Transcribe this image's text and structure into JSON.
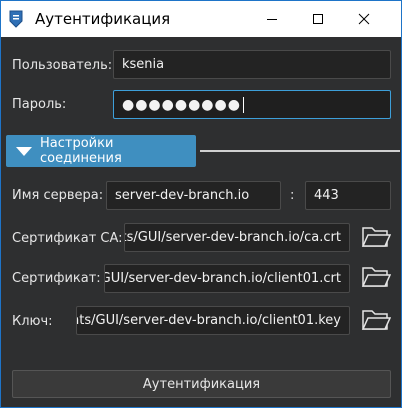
{
  "window": {
    "title": "Аутентификация"
  },
  "form": {
    "user_label": "Пользователь:",
    "user_value": "ksenia",
    "password_label": "Пароль:",
    "password_value": "●●●●●●●●●",
    "section_label": "Настройки соединения",
    "server_label": "Имя сервера:",
    "server_value": "server-dev-branch.io",
    "port_separator": ":",
    "port_value": "443",
    "ca_label": "Сертификат CA:",
    "ca_value": "ts/GUI/server-dev-branch.io/ca.crt",
    "cert_label": "Сертификат:",
    "cert_value": "/GUI/server-dev-branch.io/client01.crt",
    "key_label": "Ключ:",
    "key_value": "nts/GUI/server-dev-branch.io/client01.key",
    "submit_label": "Аутентификация"
  },
  "icons": [
    "app-icon",
    "minimize-icon",
    "maximize-icon",
    "close-icon",
    "triangle-down-icon",
    "folder-icon"
  ],
  "colors": {
    "accent": "#3f8fc0",
    "focus_border": "#3d9fd9",
    "background": "#2e2f30",
    "field_background": "#232323"
  }
}
